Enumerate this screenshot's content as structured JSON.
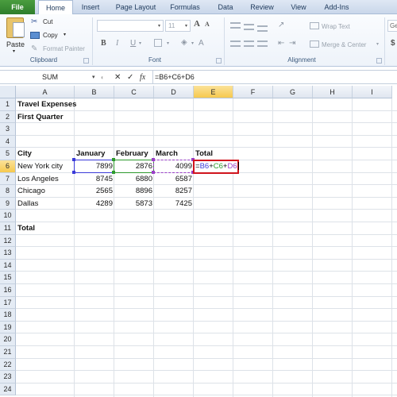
{
  "ribbon_tabs": [
    {
      "label": "File"
    },
    {
      "label": "Home"
    },
    {
      "label": "Insert"
    },
    {
      "label": "Page Layout"
    },
    {
      "label": "Formulas"
    },
    {
      "label": "Data"
    },
    {
      "label": "Review"
    },
    {
      "label": "View"
    },
    {
      "label": "Add-Ins"
    }
  ],
  "ribbon": {
    "clipboard": {
      "label": "Clipboard",
      "paste": "Paste",
      "cut": "Cut",
      "copy": "Copy",
      "format_painter": "Format Painter"
    },
    "font": {
      "label": "Font",
      "font_name": "",
      "font_size": "11",
      "bold": "B",
      "italic": "I",
      "underline": "U",
      "grow": "A",
      "shrink": "A",
      "font_color": "A"
    },
    "alignment": {
      "label": "Alignment",
      "wrap_text": "Wrap Text",
      "merge_center": "Merge & Center"
    },
    "number": {
      "format": "Ge",
      "currency": "$"
    }
  },
  "formula_bar": {
    "name_box": "SUM",
    "cancel_icon": "✕",
    "enter_icon": "✓",
    "function_icon": "fx",
    "formula": "=B6+C6+D6"
  },
  "columns": [
    "A",
    "B",
    "C",
    "D",
    "E",
    "F",
    "G",
    "H",
    "I"
  ],
  "rows": [
    "1",
    "2",
    "3",
    "4",
    "5",
    "6",
    "7",
    "8",
    "9",
    "10",
    "11",
    "12",
    "13",
    "14",
    "15",
    "16",
    "17",
    "18",
    "19",
    "20",
    "21",
    "22",
    "23",
    "24"
  ],
  "selected_column": "E",
  "selected_row": "6",
  "sheet": {
    "title": "Travel Expenses",
    "subtitle": "First Quarter",
    "headers": [
      "City",
      "January",
      "February",
      "March",
      "Total"
    ],
    "data": [
      {
        "city": "New York city",
        "jan": "7899",
        "feb": "2876",
        "mar": "4099",
        "total": ""
      },
      {
        "city": "Los Angeles",
        "jan": "8745",
        "feb": "6880",
        "mar": "6587",
        "total": ""
      },
      {
        "city": "Chicago",
        "jan": "2565",
        "feb": "8896",
        "mar": "8257",
        "total": ""
      },
      {
        "city": "Dallas",
        "jan": "4289",
        "feb": "5873",
        "mar": "7425",
        "total": ""
      }
    ],
    "total_label": "Total",
    "editing_cell": {
      "ref": "E6",
      "parts": [
        {
          "text": "=",
          "ref": null
        },
        {
          "text": "B6",
          "ref": "B"
        },
        {
          "text": "+",
          "ref": null
        },
        {
          "text": "C6",
          "ref": "C"
        },
        {
          "text": "+",
          "ref": null
        },
        {
          "text": "D6",
          "ref": "D"
        }
      ]
    }
  },
  "colors": {
    "ref_b": "#3b3bd9",
    "ref_c": "#2d9a2d",
    "ref_d": "#9b3fc8",
    "active_border": "#d0141d",
    "file_tab": "#2e7d2b",
    "header_highlight": "#f6c94e"
  }
}
